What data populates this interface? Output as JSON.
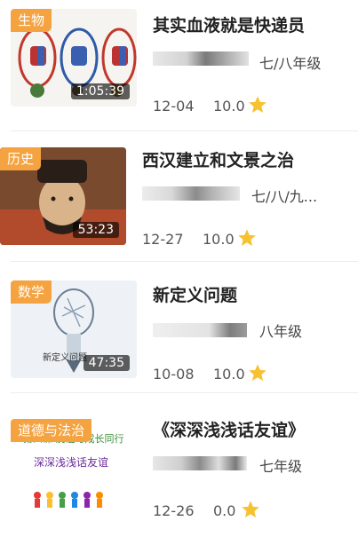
{
  "colors": {
    "badge": "#f4a340",
    "star": "#f7c12f"
  },
  "items": [
    {
      "subject": "生物",
      "duration": "1:05:39",
      "title": "其实血液就是快递员",
      "grade": "七/八年级",
      "date": "12-04",
      "score": "10.0",
      "icon": "star-icon"
    },
    {
      "subject": "历史",
      "duration": "53:23",
      "title": "西汉建立和文景之治",
      "grade": "七/八/九...",
      "date": "12-27",
      "score": "10.0",
      "icon": "star-icon"
    },
    {
      "subject": "数学",
      "duration": "47:35",
      "title": "新定义问题",
      "grade": "八年级",
      "date": "10-08",
      "score": "10.0",
      "icon": "star-icon",
      "thumb_text": "新定义问题"
    },
    {
      "subject": "道德与法治",
      "duration": "",
      "title": "《深深浅浅话友谊》",
      "grade": "七年级",
      "date": "12-26",
      "score": "0.0",
      "icon": "star-icon",
      "thumb_text": "深深浅浅话友谊",
      "thumb_text2": "第四课  友谊与成长同行"
    }
  ]
}
